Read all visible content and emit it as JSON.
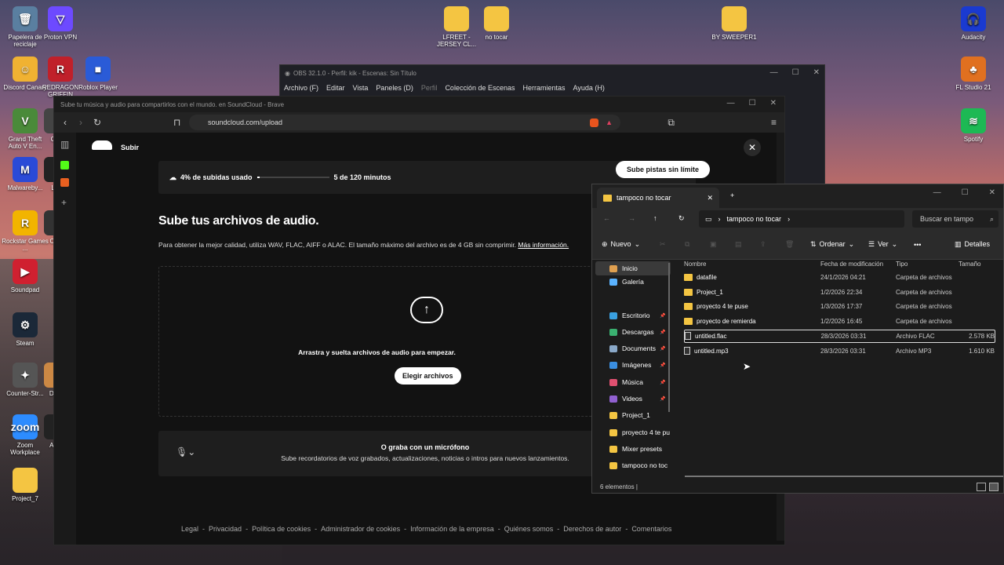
{
  "desktop": {
    "icons": [
      {
        "label": "Papelera de reciclaje",
        "color": "#5a7fa0",
        "glyph": "🗑"
      },
      {
        "label": "Proton VPN",
        "color": "#6d4aff",
        "glyph": "▽"
      },
      {
        "label": "Discord Canary",
        "color": "#f0b232",
        "glyph": "☺"
      },
      {
        "label": "REDRAGON GRIFFIN",
        "color": "#c0202a",
        "glyph": "R"
      },
      {
        "label": "Roblox Player",
        "color": "#2a5bd7",
        "glyph": "■"
      },
      {
        "label": "Grand Theft Auto V En...",
        "color": "#4a8a3a",
        "glyph": "V"
      },
      {
        "label": "Cou",
        "color": "#444",
        "glyph": ""
      },
      {
        "label": "Malwareby...",
        "color": "#2a4ad7",
        "glyph": "M"
      },
      {
        "label": "Lun",
        "color": "#222",
        "glyph": ""
      },
      {
        "label": "Rockstar Games ...",
        "color": "#f2b400",
        "glyph": "R"
      },
      {
        "label": "OBS",
        "color": "#333",
        "glyph": ""
      },
      {
        "label": "Soundpad",
        "color": "#d02030",
        "glyph": "▶"
      },
      {
        "label": "Steam",
        "color": "#1b2838",
        "glyph": "⚙"
      },
      {
        "label": "Counter-Str...",
        "color": "#555",
        "glyph": "✦"
      },
      {
        "label": "Duck",
        "color": "#c84",
        "glyph": ""
      },
      {
        "label": "Zoom Workplace",
        "color": "#2d8cff",
        "glyph": "zoom"
      },
      {
        "label": "AMD",
        "color": "#222",
        "glyph": ""
      },
      {
        "label": "Project_7",
        "color": "#f4c542",
        "glyph": ""
      },
      {
        "label": "LFREET - JERSEY CL...",
        "color": "#f4c542",
        "glyph": ""
      },
      {
        "label": "no tocar",
        "color": "#f4c542",
        "glyph": ""
      },
      {
        "label": "BY SWEEPER1",
        "color": "#f4c542",
        "glyph": ""
      },
      {
        "label": "Audacity",
        "color": "#1a3ad0",
        "glyph": "🎧"
      },
      {
        "label": "FL Studio 21",
        "color": "#e07020",
        "glyph": "♣"
      },
      {
        "label": "Spotify",
        "color": "#1db954",
        "glyph": "≋"
      }
    ]
  },
  "obs": {
    "title": "OBS 32.1.0 - Perfil: kik - Escenas: Sin Título",
    "menu": [
      "Archivo (F)",
      "Editar",
      "Vista",
      "Paneles (D)",
      "Perfil",
      "Colección de Escenas",
      "Herramientas",
      "Ayuda (H)"
    ]
  },
  "brave": {
    "title": "Sube tu música y audio para compartirlos con el mundo. en SoundCloud - Brave",
    "url": "soundcloud.com/upload",
    "sc": {
      "header": "Subir",
      "usage": "4% de subidas usado",
      "usage_fraction": 0.04,
      "minutes": "5 de 120 minutos",
      "unlimited": "Sube pistas sin límite",
      "heading": "Sube tus archivos de audio.",
      "desc": "Para obtener la mejor calidad, utiliza WAV, FLAC, AIFF o ALAC. El tamaño máximo del archivo es de 4 GB sin comprimir.",
      "more": "Más información.",
      "drag": "Arrastra y suelta archivos de audio para empezar.",
      "choose": "Elegir archivos",
      "mic_title": "O graba con un micrófono",
      "mic_desc": "Sube recordatorios de voz grabados, actualizaciones, noticias o intros para nuevos lanzamientos.",
      "footer": [
        "Legal",
        "Privacidad",
        "Política de cookies",
        "Administrador de cookies",
        "Información de la empresa",
        "Quiénes somos",
        "Derechos de autor",
        "Comentarios"
      ]
    }
  },
  "explorer": {
    "tab": "tampoco no tocar",
    "crumb": "tampoco no tocar",
    "search": "Buscar en tampo",
    "new": "Nuevo",
    "sort": "Ordenar",
    "view": "Ver",
    "details": "Detalles",
    "columns": [
      "Nombre",
      "Fecha de modificación",
      "Tipo",
      "Tamaño"
    ],
    "nav": [
      "Inicio",
      "Galería",
      "Escritorio",
      "Descargas",
      "Documents",
      "Imágenes",
      "Música",
      "Videos",
      "Project_1",
      "proyecto 4 te pu",
      "Mixer presets",
      "tampoco no toc"
    ],
    "files": [
      {
        "name": "datafile",
        "date": "24/1/2026 04:21",
        "type": "Carpeta de archivos",
        "size": "",
        "kind": "folder"
      },
      {
        "name": "Project_1",
        "date": "1/2/2026 22:34",
        "type": "Carpeta de archivos",
        "size": "",
        "kind": "folder"
      },
      {
        "name": "proyecto 4 te puse",
        "date": "1/3/2026 17:37",
        "type": "Carpeta de archivos",
        "size": "",
        "kind": "folder"
      },
      {
        "name": "proyecto de remierda",
        "date": "1/2/2026 16:45",
        "type": "Carpeta de archivos",
        "size": "",
        "kind": "folder"
      },
      {
        "name": "untitled.flac",
        "date": "28/3/2026 03:31",
        "type": "Archivo FLAC",
        "size": "2.578 KB",
        "kind": "file"
      },
      {
        "name": "untitled.mp3",
        "date": "28/3/2026 03:31",
        "type": "Archivo MP3",
        "size": "1.610 KB",
        "kind": "file"
      }
    ],
    "status": "6 elementos"
  }
}
